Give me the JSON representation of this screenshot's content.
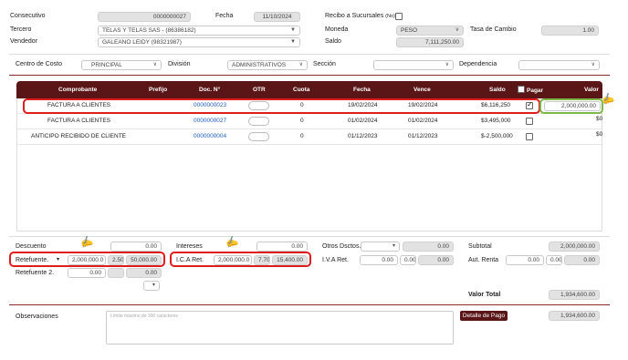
{
  "header": {
    "consecutivo_label": "Consecutivo",
    "consecutivo_value": "0000000027",
    "fecha_label": "Fecha",
    "fecha_value": "11/10/2024",
    "recibo_label": "Recibo a Sucursales",
    "recibo_suffix": "(No)",
    "tercero_label": "Tercero",
    "tercero_value": "TELAS Y TELAS SAS - (86386182)",
    "moneda_label": "Moneda",
    "moneda_value": "PESO",
    "tasa_label": "Tasa de Cambio",
    "tasa_value": "1.00",
    "vendedor_label": "Vendedor",
    "vendedor_value": "GALEANO LEIDY (98321987)",
    "saldo_label": "Saldo",
    "saldo_value": "7,111,250.00"
  },
  "filters": {
    "centro_label": "Centro de Costo",
    "centro_value": "PRINCIPAL",
    "division_label": "División",
    "division_value": "ADMINISTRATIVOS",
    "seccion_label": "Sección",
    "seccion_value": "",
    "dependencia_label": "Dependencia",
    "dependencia_value": ""
  },
  "table": {
    "columns": {
      "comprobante": "Comprobante",
      "prefijo": "Prefijo",
      "doc": "Doc. N°",
      "otr": "OTR",
      "cuota": "Cuota",
      "fecha": "Fecha",
      "vence": "Vence",
      "saldo": "Saldo",
      "pagar": "Pagar",
      "valor": "Valor"
    },
    "rows": [
      {
        "comprobante": "FACTURA A CLIENTES",
        "doc": "0000000023",
        "cuota": "0",
        "fecha": "19/02/2024",
        "vence": "19/02/2024",
        "saldo": "$6,116,250",
        "pagar": true,
        "valor": "2,000,000.00"
      },
      {
        "comprobante": "FACTURA A CLIENTES",
        "doc": "0000000027",
        "cuota": "0",
        "fecha": "01/02/2024",
        "vence": "01/02/2024",
        "saldo": "$3,495,000",
        "pagar": false,
        "valor": "$0"
      },
      {
        "comprobante": "ANTICIPO RECIBIDO DE CLIENTE",
        "doc": "0000000004",
        "cuota": "0",
        "fecha": "01/12/2023",
        "vence": "01/12/2023",
        "saldo": "$-2,500,000",
        "pagar": false,
        "valor": "$0"
      }
    ]
  },
  "totals": {
    "descuento_label": "Descuento",
    "descuento_value": "0.00",
    "intereses_label": "Intereses",
    "intereses_value": "0.00",
    "otros_label": "Otros Dsctos.",
    "otros_value": "0.00",
    "subtotal_label": "Subtotal",
    "subtotal_value": "2,000,000.00",
    "retefuente_label": "Retefuente.",
    "retefuente_base": "2,000,000.0",
    "retefuente_pct": "2.50",
    "retefuente_value": "50,000.00",
    "ica_label": "I.C.A Ret.",
    "ica_base": "2,000,000.0",
    "ica_pct": "7.70",
    "ica_value": "15,400.00",
    "iva_label": "I.V.A Ret.",
    "iva_base": "0.00",
    "iva_pct": "0.00",
    "iva_value": "0.00",
    "aut_label": "Aut. Renta",
    "aut_base": "0.00",
    "aut_pct": "0.00",
    "aut_value": "0.00",
    "retefuente2_label": "Retefuente 2.",
    "retefuente2_base": "0.00",
    "retefuente2_value": "0.00",
    "valor_total_label": "Valor Total",
    "valor_total_value": "1,934,600.00"
  },
  "footer": {
    "observaciones_label": "Observaciones",
    "observaciones_placeholder": "Límite máximo de 300 caracteres",
    "detalle_button": "Detalle de Pago",
    "detalle_value": "1,934,600.00"
  }
}
